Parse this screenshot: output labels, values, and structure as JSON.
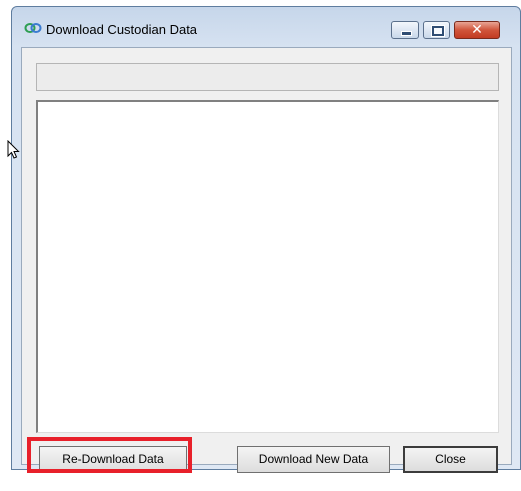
{
  "window": {
    "title": "Download Custodian Data",
    "icon": "link-chain-icon",
    "controls": [
      "minimize-icon",
      "maximize-icon",
      "close-icon"
    ],
    "close_glyph": "✕"
  },
  "status_field": {
    "value": ""
  },
  "output_area": {
    "value": ""
  },
  "buttons": {
    "redownload_label": "Re-Download Data",
    "new_data_label": "Download New Data",
    "close_label": "Close"
  },
  "annotation": {
    "color": "#e8202a",
    "target": "Re-Download Data"
  }
}
